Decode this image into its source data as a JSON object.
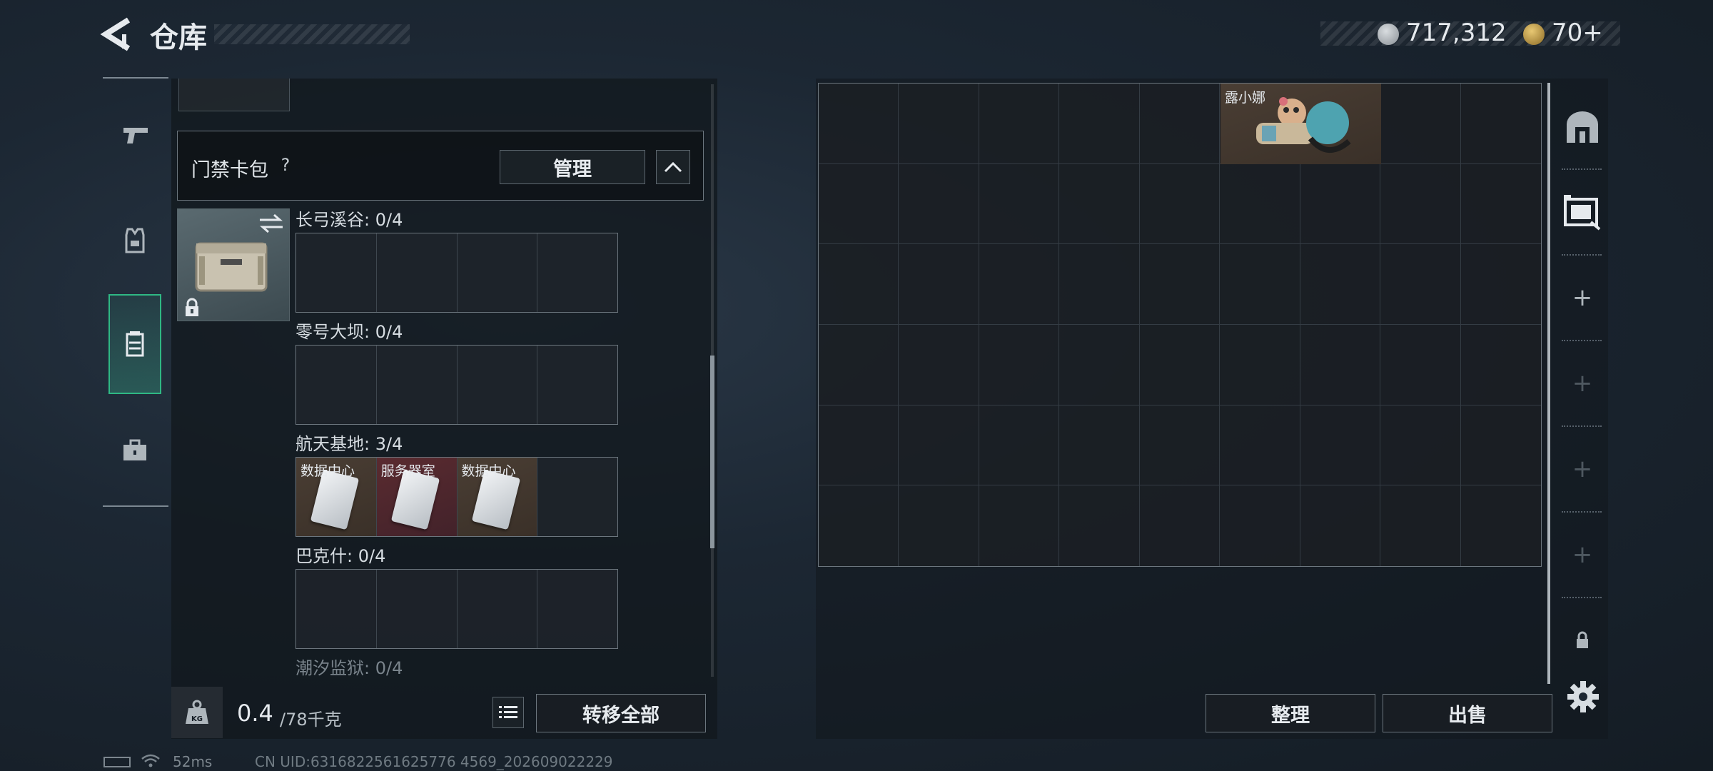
{
  "header": {
    "title": "仓库",
    "currency_primary": "717,312",
    "currency_secondary": "70+"
  },
  "left_nav": {
    "tabs": [
      {
        "name": "weapons",
        "icon": "pistol-icon"
      },
      {
        "name": "equipment",
        "icon": "vest-icon"
      },
      {
        "name": "keycards",
        "icon": "keycard-case-icon",
        "active": true
      },
      {
        "name": "items",
        "icon": "toolbox-icon"
      }
    ]
  },
  "card_bag": {
    "label": "门禁卡包",
    "help": "?",
    "manage_label": "管理",
    "regions": [
      {
        "label": "长弓溪谷: 0/4",
        "slots": [
          "",
          "",
          "",
          ""
        ]
      },
      {
        "label": "零号大坝: 0/4",
        "slots": [
          "",
          "",
          "",
          ""
        ]
      },
      {
        "label": "航天基地: 3/4",
        "slots": [
          "数据中心",
          "服务器室",
          "数据中心",
          ""
        ]
      },
      {
        "label": "巴克什: 0/4",
        "slots": [
          "",
          "",
          "",
          ""
        ]
      },
      {
        "label": "潮汐监狱: 0/4"
      }
    ]
  },
  "left_footer": {
    "weight_icon_text": "KG",
    "weight_current": "0.4",
    "weight_max": "/78千克",
    "transfer_all_label": "转移全部"
  },
  "storage": {
    "columns": 9,
    "rows": 6,
    "items": [
      {
        "name": "露小娜"
      }
    ]
  },
  "right_tabs": [
    {
      "icon": "archway-icon"
    },
    {
      "icon": "container-scan-icon"
    },
    {
      "icon": "add-icon"
    },
    {
      "icon": "add-icon-disabled"
    },
    {
      "icon": "add-icon-disabled"
    },
    {
      "icon": "add-icon-disabled"
    },
    {
      "icon": "lock-icon"
    }
  ],
  "right_footer": {
    "sort_label": "整理",
    "sell_label": "出售"
  },
  "status_bar": {
    "ping": "52ms",
    "uid": "CN UID:6316822561625776 4569_202609022229"
  },
  "colors": {
    "accent_green": "#2fb884",
    "item_brown": "#4a3e34",
    "item_red": "#5a2b30"
  }
}
